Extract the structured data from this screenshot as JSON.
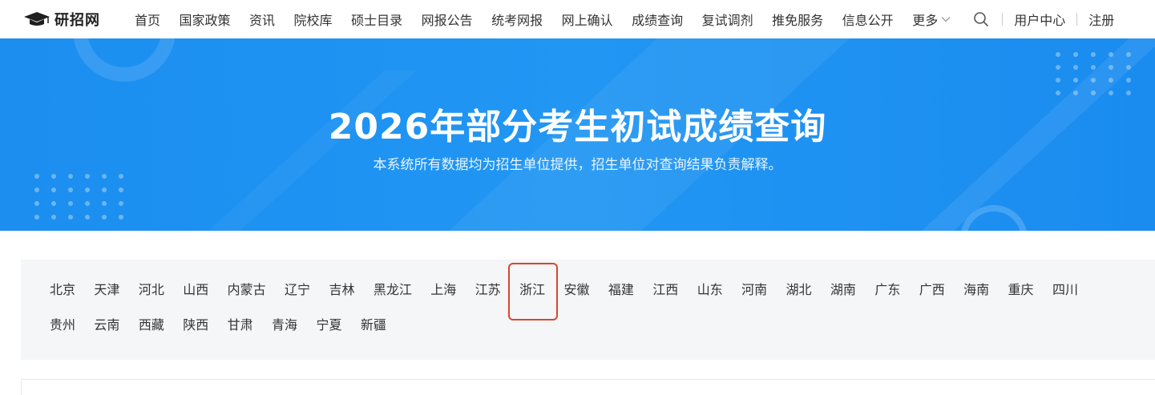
{
  "header": {
    "logo_text": "研招网",
    "nav": [
      "首页",
      "国家政策",
      "资讯",
      "院校库",
      "硕士目录",
      "网报公告",
      "统考网报",
      "网上确认",
      "成绩查询",
      "复试调剂",
      "推免服务",
      "信息公开"
    ],
    "more_label": "更多",
    "user_center": "用户中心",
    "register": "注册"
  },
  "banner": {
    "title": "2026年部分考生初试成绩查询",
    "subtitle": "本系统所有数据均为招生单位提供，招生单位对查询结果负责解释。"
  },
  "provinces": {
    "row1": [
      "北京",
      "天津",
      "河北",
      "山西",
      "内蒙古",
      "辽宁",
      "吉林",
      "黑龙江",
      "上海",
      "江苏",
      "浙江",
      "安徽",
      "福建",
      "江西",
      "山东",
      "河南",
      "湖北",
      "湖南",
      "广东",
      "广西",
      "海南",
      "重庆",
      "四川"
    ],
    "row2": [
      "贵州",
      "云南",
      "西藏",
      "陕西",
      "甘肃",
      "青海",
      "宁夏",
      "新疆"
    ],
    "selected": "浙江"
  },
  "colors": {
    "banner_blue": "#1b8ef0",
    "highlight_red": "#d9462f",
    "panel_bg": "#f5f6f8"
  }
}
